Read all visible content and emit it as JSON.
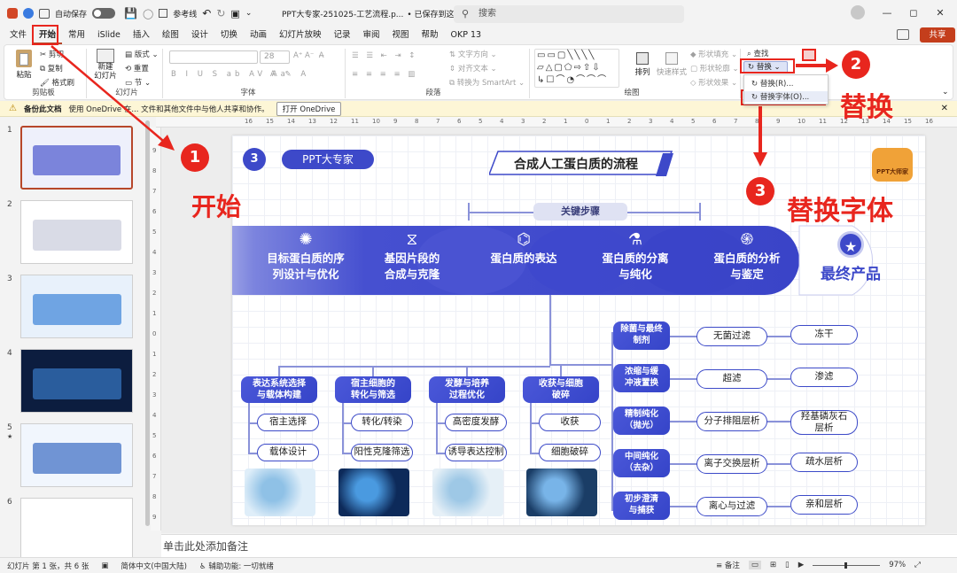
{
  "titlebar": {
    "autosave_label": "自动保存",
    "autosave_state": "关",
    "reference_label": "参考线",
    "doc_title": "PPT大专家-251025-工艺流程.p...",
    "save_status": "• 已保存到这台电脑",
    "search_placeholder": "搜索"
  },
  "menu": [
    "文件",
    "开始",
    "常用",
    "iSlide",
    "插入",
    "绘图",
    "设计",
    "切换",
    "动画",
    "幻灯片放映",
    "记录",
    "审阅",
    "视图",
    "帮助",
    "OKP 13"
  ],
  "share_label": "共享",
  "ribbon": {
    "clipboard": {
      "paste": "粘贴",
      "cut": "剪切",
      "copy": "复制",
      "format_painter": "格式刷",
      "label": "剪贴板"
    },
    "slides": {
      "new_slide": "新建\n幻灯片",
      "layout": "版式",
      "reset": "重置",
      "section": "节",
      "label": "幻灯片"
    },
    "font": {
      "size": "28",
      "label": "字体"
    },
    "paragraph": {
      "text_direction": "文字方向",
      "align_text": "对齐文本",
      "smartart": "转换为 SmartArt",
      "label": "段落"
    },
    "drawing": {
      "arrange": "排列",
      "quick_styles": "快速样式",
      "shape_fill": "形状填充",
      "shape_outline": "形状轮廓",
      "shape_effects": "形状效果",
      "label": "绘图"
    },
    "editing": {
      "find": "查找",
      "replace": "替换",
      "replace_menu": "替换(R)...",
      "replace_font": "替换字体(O)..."
    }
  },
  "notice": {
    "title": "备份此文档",
    "text": "使用 OneDrive 在... 文件和其他文件中与他人共享和协作。",
    "button": "打开 OneDrive"
  },
  "ruler_top": [
    "16",
    "15",
    "14",
    "13",
    "12",
    "11",
    "10",
    "9",
    "8",
    "7",
    "6",
    "5",
    "4",
    "3",
    "2",
    "1",
    "0",
    "1",
    "2",
    "3",
    "4",
    "5",
    "6",
    "7",
    "8",
    "9",
    "10",
    "11",
    "12",
    "13",
    "14",
    "15",
    "16"
  ],
  "ruler_left": [
    "9",
    "8",
    "7",
    "6",
    "5",
    "4",
    "3",
    "2",
    "1",
    "0",
    "1",
    "2",
    "3",
    "4",
    "5",
    "6",
    "7",
    "8",
    "9"
  ],
  "thumbnails": [
    {
      "num": "1",
      "star": false,
      "colors": [
        "#eef0fb",
        "#3d49c9"
      ]
    },
    {
      "num": "2",
      "star": false,
      "colors": [
        "#ffffff",
        "#c4c8d8"
      ]
    },
    {
      "num": "3",
      "star": false,
      "colors": [
        "#e8f1fb",
        "#2e7bd6"
      ]
    },
    {
      "num": "4",
      "star": false,
      "colors": [
        "#0c1d3f",
        "#3a7fd0"
      ]
    },
    {
      "num": "5",
      "star": true,
      "colors": [
        "#f1f6fd",
        "#2b5fbf"
      ]
    },
    {
      "num": "6",
      "star": false,
      "colors": [
        "#ffffff",
        "#ffffff"
      ]
    }
  ],
  "annotations": {
    "n1": "1",
    "n2": "2",
    "n3": "3",
    "start": "开始",
    "replace": "替换",
    "replace_font": "替换字体"
  },
  "slide": {
    "number": "3",
    "brand": "PPT大专家",
    "title": "合成人工蛋白质的流程",
    "key_steps": "关键步骤",
    "logo_text": "PPT大师家",
    "stages": [
      {
        "text": "目标蛋白质的序\n列设计与优化",
        "icon": "virus-icon"
      },
      {
        "text": "基因片段的\n合成与克隆",
        "icon": "dna-icon"
      },
      {
        "text": "蛋白质的表达",
        "icon": "molecule-icon"
      },
      {
        "text": "蛋白质的分离\n与纯化",
        "icon": "test-tube-icon"
      },
      {
        "text": "蛋白质的分析\n与鉴定",
        "icon": "fingerprint-icon"
      }
    ],
    "final_product": "最终产品",
    "branches": [
      {
        "head": "表达系统选择\n与载体构建",
        "items": [
          "宿主选择",
          "载体设计"
        ]
      },
      {
        "head": "宿主细胞的\n转化与筛选",
        "items": [
          "转化/转染",
          "阳性克隆筛选"
        ]
      },
      {
        "head": "发酵与培养\n过程优化",
        "items": [
          "高密度发酵",
          "诱导表达控制"
        ]
      },
      {
        "head": "收获与细胞\n破碎",
        "items": [
          "收获",
          "细胞破碎"
        ]
      }
    ],
    "purification": [
      {
        "head": "除菌与最终\n制剂",
        "a": "无菌过滤",
        "b": "冻干"
      },
      {
        "head": "浓缩与缓\n冲液置换",
        "a": "超滤",
        "b": "渗滤"
      },
      {
        "head": "精制纯化\n（抛光）",
        "a": "分子排阻层析",
        "b": "羟基磷灰石\n层析"
      },
      {
        "head": "中间纯化\n（去杂）",
        "a": "离子交换层析",
        "b": "疏水层析"
      },
      {
        "head": "初步澄清\n与捕获",
        "a": "离心与过滤",
        "b": "亲和层析"
      }
    ]
  },
  "notes_placeholder": "单击此处添加备注",
  "status": {
    "slide_info": "幻灯片 第 1 张，共 6 张",
    "language": "简体中文(中国大陆)",
    "accessibility": "辅助功能: 一切就绪",
    "notes": "备注",
    "zoom": "97%"
  }
}
